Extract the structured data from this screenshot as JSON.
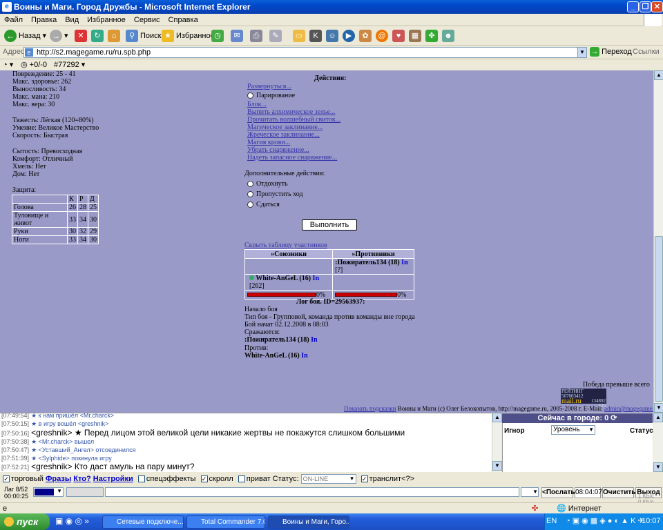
{
  "window": {
    "title": "Воины и Маги. Город Дружбы - Microsoft Internet Explorer"
  },
  "menu": [
    "Файл",
    "Правка",
    "Вид",
    "Избранное",
    "Сервис",
    "Справка"
  ],
  "toolbar": {
    "back": "Назад",
    "search": "Поиск",
    "favorites": "Избранное",
    "go": "Переход",
    "links": "Ссылки"
  },
  "address": {
    "label": "Адрес:",
    "url": "http://s2.magegame.ru/ru.spb.php"
  },
  "linksbar": {
    "ratio": "+0/-0",
    "id": "#77292"
  },
  "stats": {
    "damage": "Повреждение: 25 - 41",
    "hp": "Макс. здоровье: 262",
    "stamina": "Выносливость: 34",
    "mana": "Макс. мана: 210",
    "faith": "Макс. вера: 30",
    "weight": "Тяжесть: Лёгкая (120=80%)",
    "skill": "Умение: Великое Мастерство",
    "speed": "Скорость: Быстрая",
    "satiety": "Сытость: Превосходная",
    "comfort": "Комфорт: Отличный",
    "drunk": "Хмель: Нет",
    "home": "Дом: Нет",
    "protection_label": "Защита:"
  },
  "protection": {
    "headers": [
      "К",
      "Р",
      "Д"
    ],
    "rows": [
      [
        "Голова",
        "26",
        "28",
        "25"
      ],
      [
        "Туловище и живот",
        "33",
        "34",
        "30"
      ],
      [
        "Руки",
        "30",
        "32",
        "29"
      ],
      [
        "Ноги",
        "33",
        "34",
        "30"
      ]
    ]
  },
  "actions": {
    "title": "Действия:",
    "items": [
      "Развернуться...",
      "Парирование",
      "Блок...",
      "Выпить алхимическое зелье...",
      "Прочитать волшебный свиток...",
      "Магическое заклинание...",
      "Жреческое заклинание...",
      "Магия крови...",
      "Убрать снаряжение...",
      "Надеть запасное снаряжение..."
    ],
    "extra_title": "Дополнительные действия:",
    "extra": [
      "Отдохнуть",
      "Пропустить ход",
      "Сдаться"
    ],
    "execute": "Выполнить"
  },
  "participants": {
    "hide_link": "Скрыть таблицу участников",
    "allies_header": "»Союзники",
    "enemies_header": "»Противники",
    "enemy_name": ":Пожиратель134 (18)",
    "enemy_info": "In",
    "enemy_q": "[?]",
    "ally_name": "White-AnGeL (16)",
    "ally_info": "In",
    "ally_hp": "[262]",
    "ally_pct": "0%",
    "enemy_pct": "0%"
  },
  "log": {
    "title": "Лог боя. ID=29563937:",
    "start": "Начало боя",
    "type": "Тип боя - Групповой, команда против команды вне города",
    "began": "Бой начат 02.12.2008 в 08:03",
    "fight": "Сражаются:",
    "side1": ":Пожиратель134 (18)",
    "side1_info": "In",
    "vs": "Против:",
    "side2": "White-AnGeL (16)",
    "side2_info": "In"
  },
  "footer": {
    "victory": "Победа превыше всего",
    "hints_link": "Показать подсказки",
    "copyright": "Воины и Маги (c) Олег Белокопытов, http://magegame.ru, 2005-2008 г. E-Mail:",
    "email": "admin@magegame.ru",
    "rating": "РЕЙТИНГ 567003412",
    "mail": "mail.ru",
    "counter1": "134892",
    "counter2": "620"
  },
  "chat": [
    {
      "time": "[07:49:54]",
      "text": "★ к нам пришёл <Mr.charck>",
      "kind": "sys"
    },
    {
      "time": "[07:50:15]",
      "text": "★ в игру вошёл <greshnik>",
      "kind": "sys"
    },
    {
      "time": "[07:50:16]",
      "text": "<greshnik> ★ Перед лицом этой великой цели никакие жертвы не покажутся слишком большими",
      "kind": "msg"
    },
    {
      "time": "[07:50:38]",
      "text": "★ <Mr.charck> вышел",
      "kind": "sys"
    },
    {
      "time": "[07:50:47]",
      "text": "★ <Уставший_Ангел> отсоединился",
      "kind": "sys"
    },
    {
      "time": "[07:51:39]",
      "text": "★ <Sylphide> покинула игру",
      "kind": "sys"
    },
    {
      "time": "[07:52:21]",
      "text": "<greshnik> Кто даст амуль на пару минут?",
      "kind": "msg"
    }
  ],
  "city": {
    "title": "Сейчас в городе: 0",
    "ignore": "Игнор",
    "level": "Уровень",
    "status": "Статус"
  },
  "options": {
    "trade": "торговый",
    "phrases": "Фразы",
    "who": "Кто?",
    "settings": "Настройки",
    "effects": "спецэффекты",
    "scroll": "скролл",
    "private": "приват",
    "status_label": "Статус:",
    "status_value": "ON-LINE",
    "translit": "транслит<?>"
  },
  "input": {
    "lag": "Лаг 8/52",
    "timer": "00:00:25",
    "send": "<Послать",
    "time": "08:04:07",
    "clear": "Очистить",
    "exit": "Выход",
    "kb": "1 КБ/с",
    "kb2": "0 КБ/с"
  },
  "statusbar": {
    "zone": "Интернет"
  },
  "taskbar": {
    "start": "пуск",
    "tasks": [
      "Сетевые подключе...",
      "Total Commander 7.0...",
      "Воины и Маги, Горо..."
    ],
    "lang": "EN",
    "clock": "10:07"
  }
}
